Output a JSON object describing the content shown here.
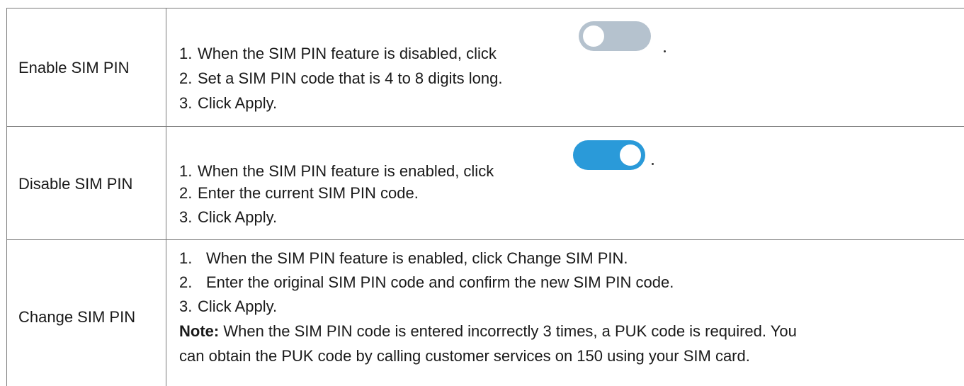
{
  "rows": [
    {
      "label": "Enable SIM PIN",
      "steps": [
        {
          "num": "1.",
          "text": "When the SIM PIN feature is disabled, click"
        },
        {
          "num": "2.",
          "text": "Set a SIM PIN code that is 4 to 8 digits long."
        },
        {
          "num": "3.",
          "text": "Click Apply."
        }
      ],
      "toggle": {
        "state": "off",
        "color": "#b5c2ce"
      }
    },
    {
      "label": "Disable SIM PIN",
      "steps": [
        {
          "num": "1.",
          "text": "When the SIM PIN feature is enabled, click"
        },
        {
          "num": "2.",
          "text": "Enter the current SIM PIN code."
        },
        {
          "num": "3.",
          "text": "Click Apply."
        }
      ],
      "toggle": {
        "state": "on",
        "color": "#2a9ad9"
      }
    },
    {
      "label": "Change SIM PIN",
      "steps": [
        {
          "num": "1.",
          "text": "When the SIM PIN feature is enabled, click Change SIM PIN."
        },
        {
          "num": "2.",
          "text": "Enter the original SIM PIN code and confirm the new SIM PIN code."
        },
        {
          "num": "3.",
          "text": "Click Apply."
        }
      ],
      "note": {
        "prefix": "Note:",
        "line1": " When the SIM PIN code is entered incorrectly 3 times, a PUK code is required. You",
        "line2": "can obtain the PUK code by calling customer services on 150 using your SIM card."
      }
    }
  ]
}
